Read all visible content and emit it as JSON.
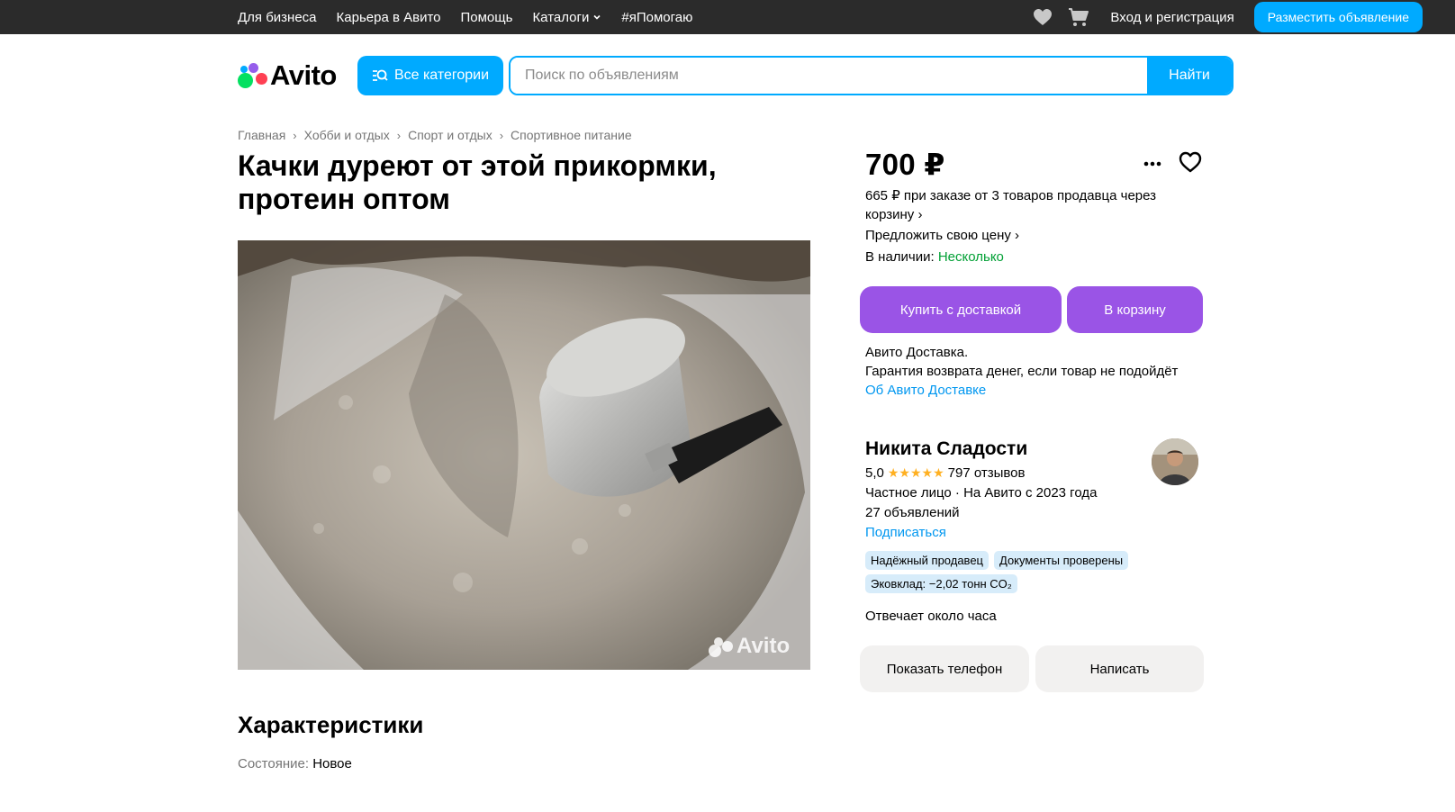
{
  "topbar": {
    "nav": [
      {
        "label": "Для бизнеса"
      },
      {
        "label": "Карьера в Авито"
      },
      {
        "label": "Помощь"
      },
      {
        "label": "Каталоги"
      },
      {
        "label": "#яПомогаю"
      }
    ],
    "login_label": "Вход и регистрация",
    "post_label": "Разместить объявление",
    "icons": [
      "heart-icon",
      "cart-icon",
      "chevron-down-icon"
    ]
  },
  "header": {
    "logo_text": "Avito",
    "categories_label": "Все категории",
    "search_placeholder": "Поиск по объявлениям",
    "search_button": "Найти"
  },
  "breadcrumbs": [
    "Главная",
    "Хобби и отдых",
    "Спорт и отдых",
    "Спортивное питание"
  ],
  "listing": {
    "title": "Качки дуреют от этой прикормки, протеин оптом",
    "photo_watermark": "Avito",
    "characteristics_heading": "Характеристики",
    "condition_key": "Состояние:",
    "condition_value": "Новое"
  },
  "pricing": {
    "price": "700 ₽",
    "cart_price": "665 ₽ при заказе от 3 товаров продавца через корзину",
    "offer_label": "Предложить свою цену",
    "stock_key": "В наличии:",
    "stock_value": "Несколько",
    "buy_button": "Купить с доставкой",
    "cart_button": "В корзину",
    "delivery_line1": "Авито Доставка.",
    "delivery_line2": "Гарантия возврата денег, если товар не подойдёт",
    "delivery_link": "Об Авито Доставке"
  },
  "seller": {
    "name": "Никита Сладости",
    "rating": "5,0",
    "stars": "★★★★★",
    "reviews": "797 отзывов",
    "type_line": "Частное лицо · На Авито с 2023 года",
    "ads_count": "27 объявлений",
    "subscribe_link": "Подписаться",
    "badges": [
      "Надёжный продавец",
      "Документы проверены",
      "Эковклад: −2,02 тонн CO₂"
    ],
    "response_time": "Отвечает около часа",
    "phone_button": "Показать телефон",
    "write_button": "Написать"
  },
  "colors": {
    "accent_blue": "#00aaff",
    "purple": "#9a54e6",
    "link_blue": "#0097f0",
    "green": "#02a035",
    "topbar": "#2b2b2b"
  }
}
